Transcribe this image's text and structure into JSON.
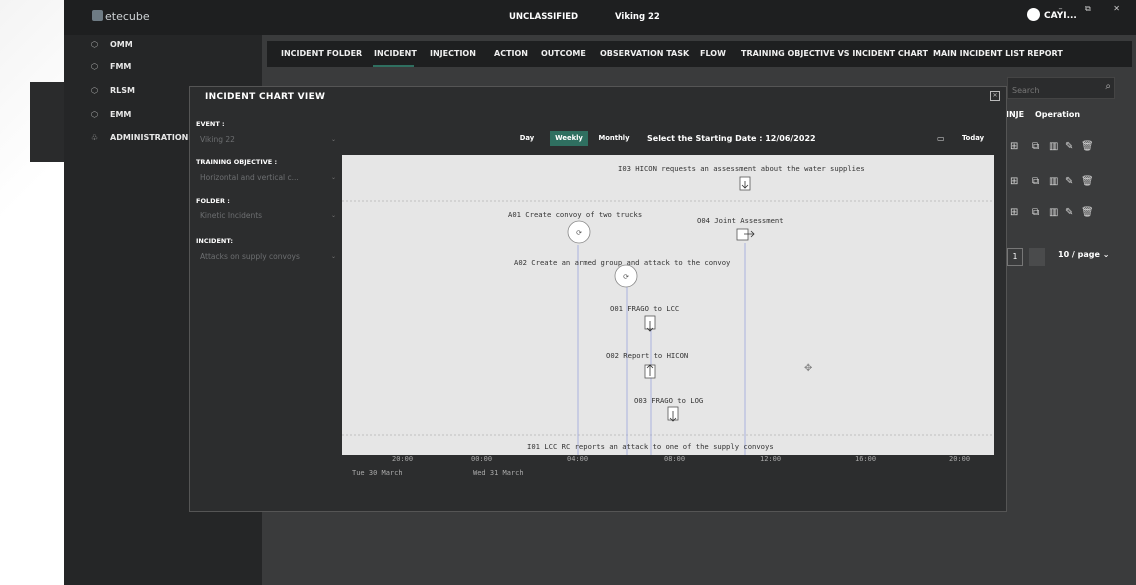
{
  "app": {
    "logo": "etecube",
    "classification": "UNCLASSIFIED",
    "event_name": "Viking 22",
    "user_name": "CAYI...",
    "window_controls": "– ⧉ ✕"
  },
  "sidebar": {
    "items": [
      {
        "label": "OMM",
        "icon": "cube-icon"
      },
      {
        "label": "FMM",
        "icon": "cube-icon"
      },
      {
        "label": "RLSM",
        "icon": "cube-icon"
      },
      {
        "label": "EMM",
        "icon": "cube-icon"
      },
      {
        "label": "ADMINISTRATION",
        "icon": "users-icon"
      }
    ]
  },
  "menu": {
    "items": [
      "INCIDENT FOLDER",
      "INCIDENT",
      "INJECTION",
      "ACTION",
      "OUTCOME",
      "OBSERVATION TASK",
      "FLOW",
      "TRAINING OBJECTIVE VS INCIDENT CHART",
      "MAIN INCIDENT LIST REPORT"
    ],
    "active": "INCIDENT"
  },
  "list": {
    "search_placeholder": "Search",
    "columns": [
      "INJE",
      "Operation"
    ],
    "row_count": 3,
    "pagination": {
      "page": "1",
      "page_size": "10 / page"
    }
  },
  "modal": {
    "title": "INCIDENT CHART VIEW",
    "fields": {
      "event": {
        "label": "EVENT :",
        "value": "Viking 22"
      },
      "training_objective": {
        "label": "TRAINING OBJECTIVE :",
        "value": "Horizontal and vertical c..."
      },
      "folder": {
        "label": "FOLDER :",
        "value": "Kinetic Incidents"
      },
      "incident": {
        "label": "INCIDENT:",
        "value": "Attacks on supply convoys"
      }
    },
    "view_buttons": [
      "Day",
      "Weekly",
      "Monthly"
    ],
    "active_view": "Weekly",
    "date_label": "Select the Starting Date : 12/06/2022",
    "today_label": "Today"
  },
  "timeline": {
    "items": [
      {
        "label": "I03 HICON requests an assessment about the water supplies",
        "kind": "injection-down"
      },
      {
        "label": "A01 Create convoy of two trucks",
        "kind": "action"
      },
      {
        "label": "O04 Joint Assessment",
        "kind": "observation-right"
      },
      {
        "label": "A02 Create an armed group and attack to the convoy",
        "kind": "action"
      },
      {
        "label": "O01 FRAGO to LCC",
        "kind": "observation-down"
      },
      {
        "label": "O02 Report to HICON",
        "kind": "observation-up"
      },
      {
        "label": "O03 FRAGO to LOG",
        "kind": "observation-down"
      },
      {
        "label": "I01 LCC RC reports an attack to one of the supply convoys",
        "kind": "injection"
      }
    ],
    "time_ticks": [
      "20:00",
      "00:00",
      "04:00",
      "08:00",
      "12:00",
      "16:00",
      "20:00"
    ],
    "dates": [
      "Tue 30 March",
      "Wed 31 March"
    ]
  }
}
